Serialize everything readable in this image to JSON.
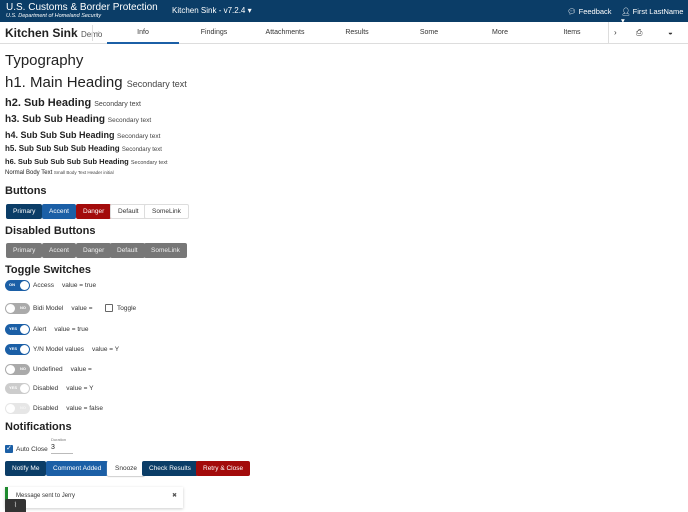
{
  "header": {
    "org": "U.S. Customs & Border Protection",
    "dept": "U.S. Department of Homeland Security",
    "app": "Kitchen Sink - v7.2.4 ▾",
    "feedback": "Feedback",
    "user": "First LastName ▾"
  },
  "nav": {
    "title": "Kitchen Sink",
    "subtitle": "Demo",
    "tabs": [
      "Info",
      "Findings",
      "Attachments",
      "Results",
      "Some",
      "More",
      "Items"
    ]
  },
  "typography": {
    "heading": "Typography",
    "h1": "h1. Main Heading",
    "h2": "h2. Sub Heading",
    "h3": "h3. Sub Sub Heading",
    "h4": "h4. Sub Sub Sub Heading",
    "h5": "h5. Sub Sub Sub Sub Heading",
    "h6": "h6. Sub Sub Sub Sub Sub Heading",
    "secondary": "Secondary text",
    "body": "Normal Body Text",
    "small": "Small Body Text Header initial"
  },
  "buttons": {
    "heading": "Buttons",
    "disabled_heading": "Disabled Buttons",
    "labels": [
      "Primary",
      "Accent",
      "Danger",
      "Default",
      "SomeLink"
    ]
  },
  "toggles": {
    "heading": "Toggle Switches",
    "checkbox_label": "Toggle",
    "items": [
      {
        "state": "ON",
        "label": "Access",
        "value": "value = true"
      },
      {
        "state": "NO",
        "label": "Bidi Model",
        "value": "value ="
      },
      {
        "state": "YES",
        "label": "Alert",
        "value": "value = true"
      },
      {
        "state": "YES",
        "label": "Y/N Model values",
        "value": "value = Y"
      },
      {
        "state": "NO",
        "label": "Undefined",
        "value": "value ="
      },
      {
        "state": "YES",
        "label": "Disabled",
        "value": "value = Y"
      },
      {
        "state": "NO",
        "label": "Disabled",
        "value": "value = false"
      }
    ]
  },
  "notifications": {
    "heading": "Notifications",
    "auto_close": "Auto Close",
    "duration_label": "Duration",
    "duration": "3",
    "buttons": [
      "Notify Me",
      "Comment Added",
      "Snooze",
      "Check Results",
      "Retry & Close"
    ],
    "toast": "Message sent to Jerry",
    "toast_close": "✖"
  }
}
